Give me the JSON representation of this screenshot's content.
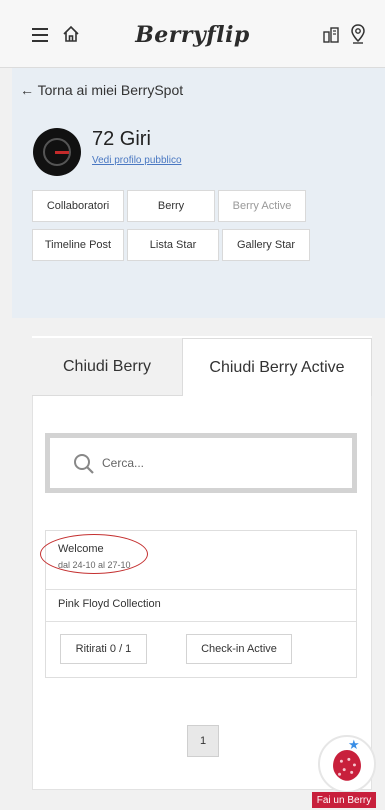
{
  "header": {
    "logo": "Berryflip",
    "menu_icon": "hamburger-menu-icon",
    "home_icon": "home-icon",
    "spot_icon": "berryspot-icon",
    "location_icon": "location-pin-icon"
  },
  "profile": {
    "back_link": "← Torna ai miei BerrySpot",
    "name": "72 Giri",
    "public_link": "Vedi profilo pubblico",
    "nav": [
      "Collaboratori",
      "Berry",
      "Berry Active",
      "Timeline Post",
      "Lista Star",
      "Gallery Star"
    ]
  },
  "tabs": {
    "close_berry": "Chiudi Berry",
    "close_berry_active": "Chiudi Berry Active"
  },
  "search": {
    "placeholder": "Cerca..."
  },
  "event": {
    "title": "Welcome",
    "dates": "dal 24-10 al 27-10",
    "subtitle": "Pink Floyd Collection",
    "withdrawn_button": "Ritirati 0 / 1",
    "checkin_button": "Check-in Active"
  },
  "pagination": {
    "current_page": "1"
  },
  "fab": {
    "label": "Fai un Berry"
  },
  "colors": {
    "accent_blue": "#4a78c2",
    "profile_bg": "#e8eef4",
    "highlight_red": "#c43030",
    "fab_red": "#c8203c"
  }
}
